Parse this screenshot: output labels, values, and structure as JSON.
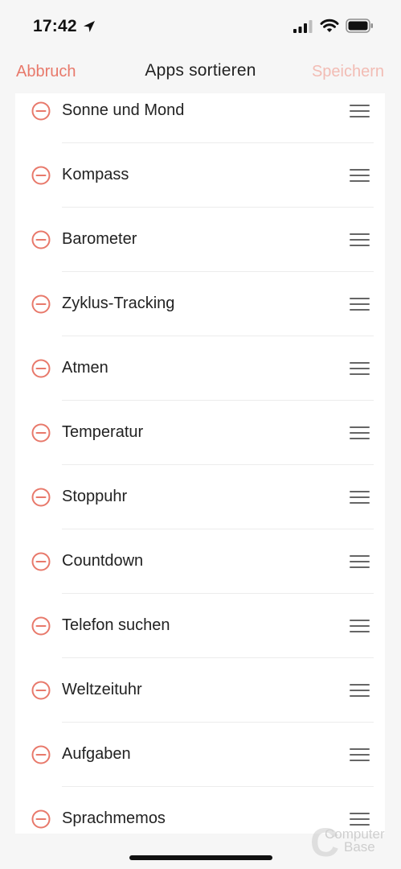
{
  "status_bar": {
    "time": "17:42",
    "icons": [
      "location-arrow-icon",
      "cellular-signal-icon",
      "wifi-icon",
      "battery-icon"
    ]
  },
  "nav": {
    "cancel_label": "Abbruch",
    "title": "Apps sortieren",
    "save_label": "Speichern"
  },
  "apps": [
    {
      "label": "Sonne und Mond"
    },
    {
      "label": "Kompass"
    },
    {
      "label": "Barometer"
    },
    {
      "label": "Zyklus-Tracking"
    },
    {
      "label": "Atmen"
    },
    {
      "label": "Temperatur"
    },
    {
      "label": "Stoppuhr"
    },
    {
      "label": "Countdown"
    },
    {
      "label": "Telefon suchen"
    },
    {
      "label": "Weltzeituhr"
    },
    {
      "label": "Aufgaben"
    },
    {
      "label": "Sprachmemos"
    }
  ],
  "row_icons": {
    "remove": "remove-circle-icon",
    "drag": "drag-handle-icon"
  },
  "colors": {
    "accent": "#e8796b",
    "accent_disabled": "#f2bcb4",
    "background": "#f6f6f6",
    "card": "#ffffff",
    "divider": "#ececec",
    "text": "#222222"
  },
  "watermark": {
    "letter": "C",
    "line1": "Computer",
    "line2": "Base"
  }
}
